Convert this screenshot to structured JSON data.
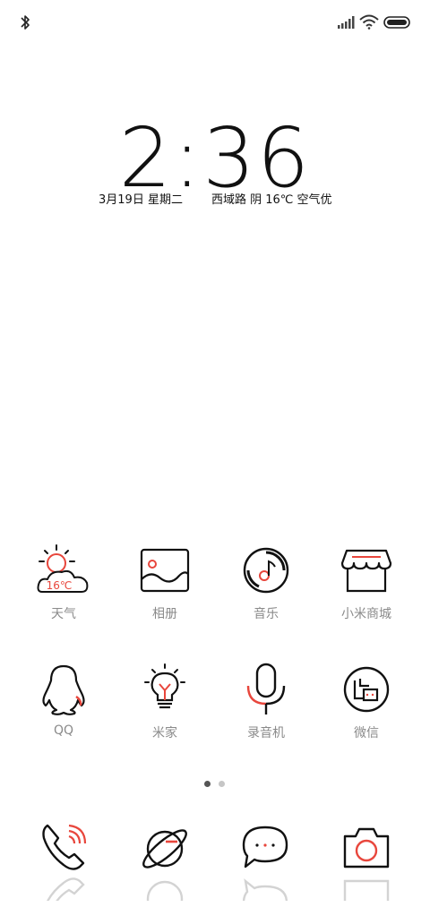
{
  "status_bar": {
    "left_icons": [
      "bluetooth-icon"
    ],
    "right_icons": [
      "signal-icon",
      "wifi-icon",
      "battery-icon"
    ]
  },
  "clock": {
    "time": "2:36",
    "date": "3月19日 星期二",
    "weather": "西域路 阴 16℃ 空气优"
  },
  "apps": [
    {
      "label": "天气",
      "icon": "weather-icon",
      "badge_text": "16℃"
    },
    {
      "label": "相册",
      "icon": "gallery-icon"
    },
    {
      "label": "音乐",
      "icon": "music-icon"
    },
    {
      "label": "小米商城",
      "icon": "store-icon"
    },
    {
      "label": "QQ",
      "icon": "qq-icon"
    },
    {
      "label": "米家",
      "icon": "mijia-icon"
    },
    {
      "label": "录音机",
      "icon": "recorder-icon"
    },
    {
      "label": "微信",
      "icon": "wechat-icon"
    }
  ],
  "page_indicator": {
    "pages": 2,
    "current": 1
  },
  "dock": [
    {
      "icon": "phone-icon"
    },
    {
      "icon": "browser-icon"
    },
    {
      "icon": "messages-icon"
    },
    {
      "icon": "camera-icon"
    }
  ],
  "colors": {
    "accent": "#e8463c",
    "stroke": "#111111",
    "label": "#8a8a8a"
  }
}
